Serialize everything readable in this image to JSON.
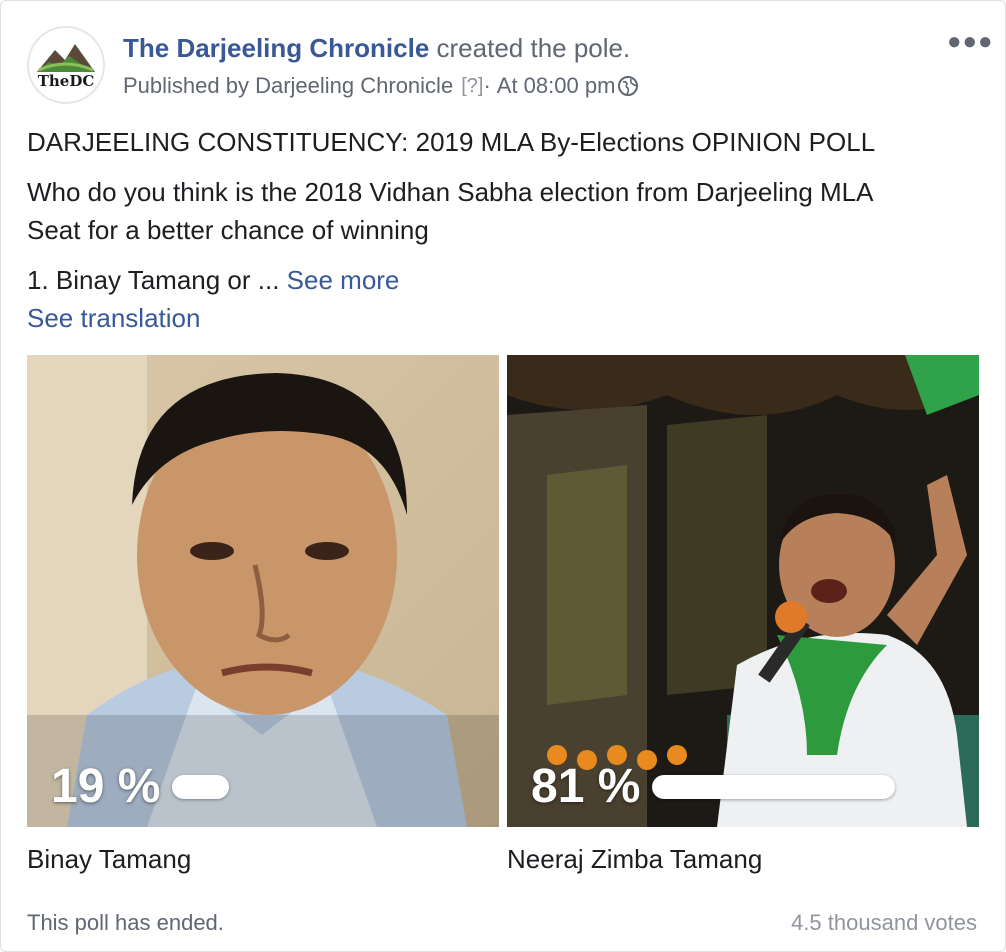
{
  "post": {
    "page_name": "The Darjeeling Chronicle",
    "action": " created the pole.",
    "published_by": "Published by Darjeeling Chronicle",
    "help_mark": "[?]",
    "time_sep": "·",
    "time": "At 08:00 pm",
    "avatar_text": "TheDC",
    "more_icon": "more-dots-icon",
    "globe_icon": "globe-icon",
    "title": "DARJEELING CONSTITUENCY: 2019 MLA By-Elections OPINION POLL",
    "question_line1": "Who do you think is the 2018 Vidhan Sabha election from Darjeeling MLA",
    "question_line2": "Seat for a better chance of winning",
    "preview": "1. Binay Tamang or ... ",
    "see_more": "See more",
    "see_translation": "See translation"
  },
  "poll": {
    "options": [
      {
        "name": "Binay Tamang",
        "percent_label": "19 %",
        "percent": 19
      },
      {
        "name": "Neeraj Zimba Tamang",
        "percent_label": "81 %",
        "percent": 81
      }
    ],
    "status": "This poll has ended.",
    "votes": "4.5 thousand votes"
  },
  "colors": {
    "link": "#385898",
    "secondary_text": "#606770",
    "bar": "#ffffff"
  }
}
